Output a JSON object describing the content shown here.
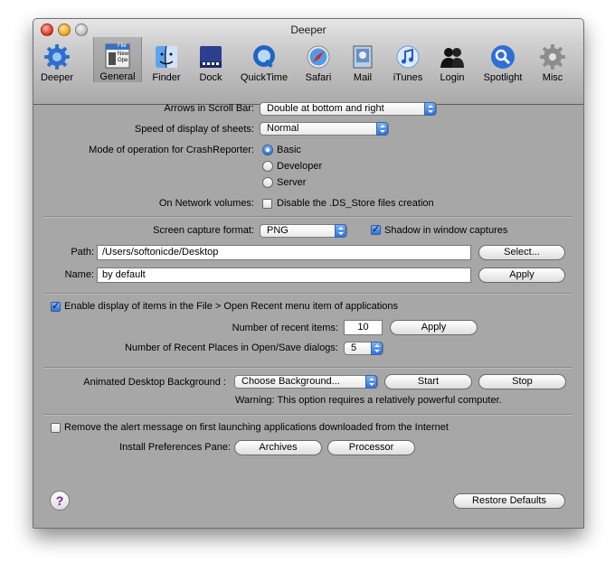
{
  "window": {
    "title": "Deeper"
  },
  "toolbar": {
    "items": [
      {
        "label": "Deeper",
        "icon": "deeper-gear-icon"
      },
      {
        "label": "General",
        "icon": "general-window-icon",
        "selected": true
      },
      {
        "label": "Finder",
        "icon": "finder-icon"
      },
      {
        "label": "Dock",
        "icon": "dock-icon"
      },
      {
        "label": "QuickTime",
        "icon": "quicktime-icon"
      },
      {
        "label": "Safari",
        "icon": "safari-icon"
      },
      {
        "label": "Mail",
        "icon": "mail-icon"
      },
      {
        "label": "iTunes",
        "icon": "itunes-icon"
      },
      {
        "label": "Login",
        "icon": "login-users-icon"
      },
      {
        "label": "Spotlight",
        "icon": "spotlight-icon"
      },
      {
        "label": "Misc",
        "icon": "misc-gear-icon"
      }
    ],
    "general_icon_text": {
      "line1": "File",
      "line2": "New",
      "line3": "Ope"
    }
  },
  "general": {
    "arrows_label": "Arrows in Scroll Bar:",
    "arrows_value": "Double at bottom and right",
    "sheets_label": "Speed of display of sheets:",
    "sheets_value": "Normal",
    "crash_label": "Mode of operation for CrashReporter:",
    "crash_options": [
      "Basic",
      "Developer",
      "Server"
    ],
    "crash_selected": "Basic",
    "network_label": "On Network volumes:",
    "network_checkbox": "Disable the .DS_Store files creation",
    "network_checked": false
  },
  "capture": {
    "format_label": "Screen capture format:",
    "format_value": "PNG",
    "shadow_label": "Shadow in window captures",
    "shadow_checked": true,
    "path_label": "Path:",
    "path_value": "/Users/softonicde/Desktop",
    "select_button": "Select...",
    "name_label": "Name:",
    "name_value": "by default",
    "apply_button": "Apply"
  },
  "recent": {
    "enable_label": "Enable display of items in the File > Open Recent menu item of applications",
    "enable_checked": true,
    "count_label": "Number of recent items:",
    "count_value": "10",
    "apply_button": "Apply",
    "places_label": "Number of Recent Places in Open/Save dialogs:",
    "places_value": "5"
  },
  "desktop": {
    "label": "Animated Desktop Background :",
    "choose_value": "Choose Background...",
    "start_button": "Start",
    "stop_button": "Stop",
    "warning": "Warning: This option requires a relatively powerful computer."
  },
  "misc": {
    "alert_label": "Remove the alert message on first launching applications downloaded from the Internet",
    "alert_checked": false,
    "install_label": "Install Preferences Pane:",
    "archives_button": "Archives",
    "processor_button": "Processor"
  },
  "footer": {
    "help_symbol": "?",
    "restore_button": "Restore Defaults"
  },
  "colors": {
    "accent": "#2f73db",
    "window_bg": "#a7a7a7"
  }
}
